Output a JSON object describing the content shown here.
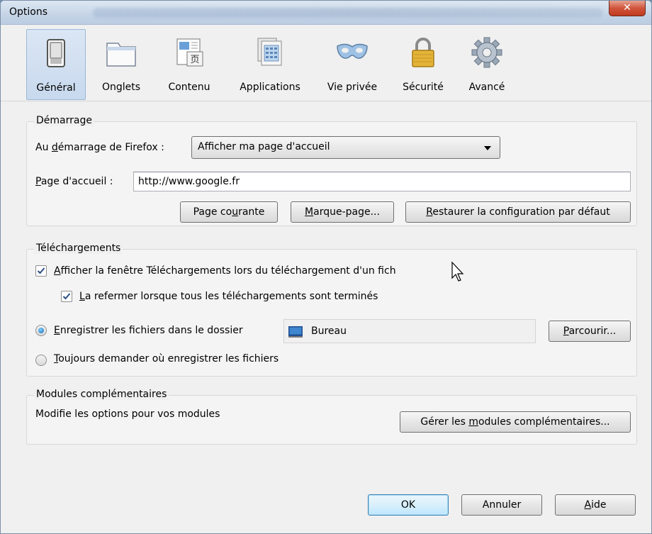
{
  "window": {
    "title": "Options",
    "close_glyph": "✕"
  },
  "toolbar": {
    "tabs": [
      {
        "label": "Général",
        "icon": "general-switch-icon"
      },
      {
        "label": "Onglets",
        "icon": "tabs-icon"
      },
      {
        "label": "Contenu",
        "icon": "content-icon"
      },
      {
        "label": "Applications",
        "icon": "applications-icon"
      },
      {
        "label": "Vie privée",
        "icon": "privacy-mask-icon"
      },
      {
        "label": "Sécurité",
        "icon": "security-lock-icon"
      },
      {
        "label": "Avancé",
        "icon": "advanced-gear-icon"
      }
    ],
    "selected": "Général"
  },
  "startup": {
    "title": "Démarrage",
    "when_label_pre": "Au ",
    "when_label_accel": "d",
    "when_label_post": "émarrage de Firefox :",
    "when_value": "Afficher ma page d'accueil",
    "home_label_accel": "P",
    "home_label_post": "age d'accueil :",
    "home_value": "http://www.google.fr",
    "btn_current_pre": "Page co",
    "btn_current_accel": "u",
    "btn_current_post": "rante",
    "btn_bookmark_accel": "M",
    "btn_bookmark_post": "arque-page...",
    "btn_restore_accel": "R",
    "btn_restore_post": "estaurer la configuration par défaut"
  },
  "downloads": {
    "title": "Téléchargements",
    "show_window_accel": "A",
    "show_window_post": "fficher la fenêtre Téléchargements lors du téléchargement d'un fich",
    "show_window_checked": true,
    "close_when_accel": "L",
    "close_when_post": "a refermer lorsque tous les téléchargements sont terminés",
    "close_when_checked": true,
    "save_to_accel": "E",
    "save_to_post": "nregistrer les fichiers dans le dossier",
    "folder_name": "Bureau",
    "browse_accel": "P",
    "browse_post": "arcourir...",
    "always_ask_accel": "T",
    "always_ask_post": "oujours demander où enregistrer les fichiers",
    "selected_option": "save_to"
  },
  "addons": {
    "title": "Modules complémentaires",
    "description": "Modifie les options pour vos modules",
    "manage_pre": "Gérer les ",
    "manage_accel": "m",
    "manage_post": "odules complémentaires..."
  },
  "footer": {
    "ok": "OK",
    "cancel": "Annuler",
    "help_accel": "A",
    "help_post": "ide"
  },
  "colors": {
    "selected_tab_bg": "#c8d9ee",
    "close_button": "#c13a1f",
    "default_button_border": "#3c7fb1"
  }
}
